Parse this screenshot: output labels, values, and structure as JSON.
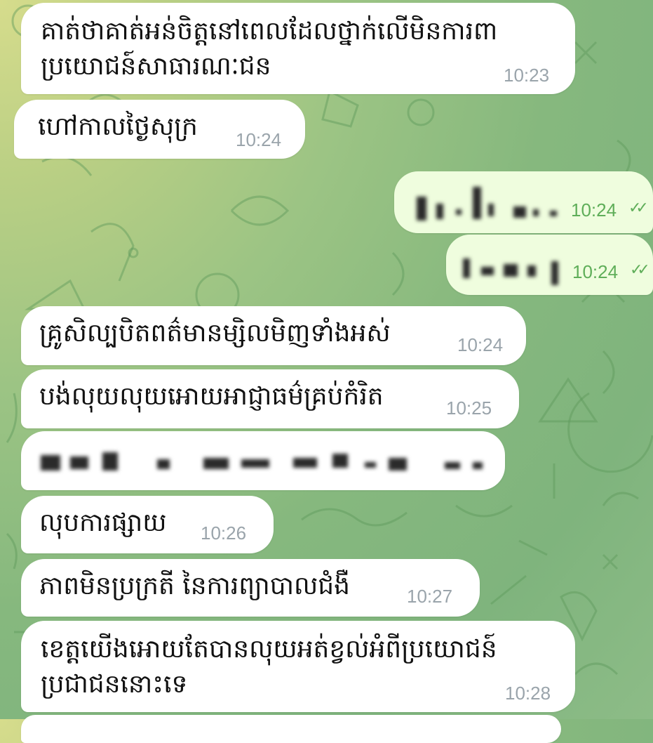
{
  "chat": {
    "messages": [
      {
        "direction": "incoming",
        "text": "គាត់ថាគាត់អន់ចិត្តនៅពេលដែលថ្នាក់លើមិនការពា\nប្រយោជន៍សាធារណៈជន",
        "time": "10:23"
      },
      {
        "direction": "incoming",
        "text": "ហៅកាលថ្ងៃសុក្រ",
        "time": "10:24"
      },
      {
        "direction": "outgoing",
        "text": "",
        "redacted": true,
        "time": "10:24",
        "status": "read"
      },
      {
        "direction": "outgoing",
        "text": "",
        "redacted": true,
        "time": "10:24",
        "status": "read"
      },
      {
        "direction": "incoming",
        "text": "គ្រូសិល្បបិតពត៌មានម្សិលមិញទាំងអស់",
        "time": "10:24"
      },
      {
        "direction": "incoming",
        "text": "បង់លុយលុយអោយអាជ្ញាធម៌គ្រប់កំរិត",
        "time": "10:25"
      },
      {
        "direction": "incoming",
        "text": "",
        "redacted": true,
        "time": ""
      },
      {
        "direction": "incoming",
        "text": "លុបការផ្សាយ",
        "time": "10:26"
      },
      {
        "direction": "incoming",
        "text": "ភាពមិនប្រក្រតី នៃការព្យាបាលជំងឺ",
        "time": "10:27"
      },
      {
        "direction": "incoming",
        "text": "ខេត្តយើងអោយតែបានលុយអត់ខ្វល់អំពីប្រយោជន៍\nប្រជាជននោះទេ",
        "time": "10:28"
      }
    ],
    "read_mark": "✓✓"
  }
}
